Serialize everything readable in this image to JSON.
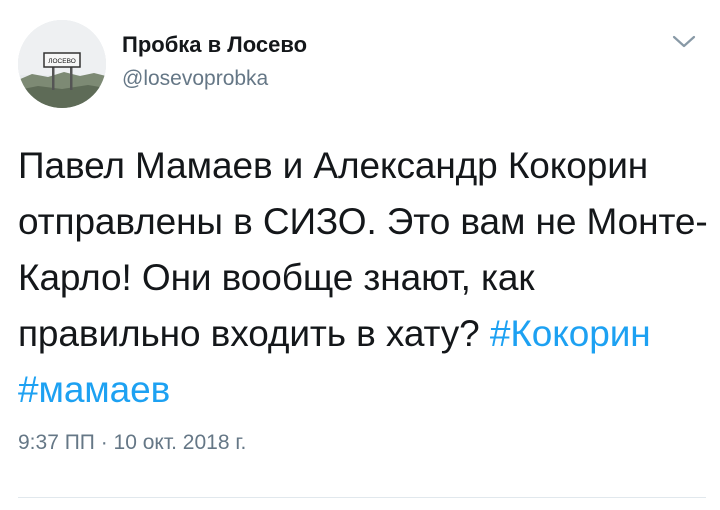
{
  "author": {
    "name": "Пробка в Лосево",
    "handle": "@losevoprobka",
    "avatar_sign_text": "ЛОСЕВО"
  },
  "menu": {
    "icon": "chevron-down-icon"
  },
  "tweet": {
    "text_before": "Павел Мамаев и Александр Кокорин отправлены в СИЗО. Это вам не Монте-Карло! Они вообще знают, как правильно входить в хату?",
    "hashtags": [
      "#Кокорин",
      "#мамаев"
    ],
    "timestamp": "9:37 ПП · 10 окт. 2018 г."
  },
  "colors": {
    "hashtag": "#1da1f2",
    "text": "#14171a",
    "secondary": "#657786",
    "divider": "#e1e8ed"
  }
}
